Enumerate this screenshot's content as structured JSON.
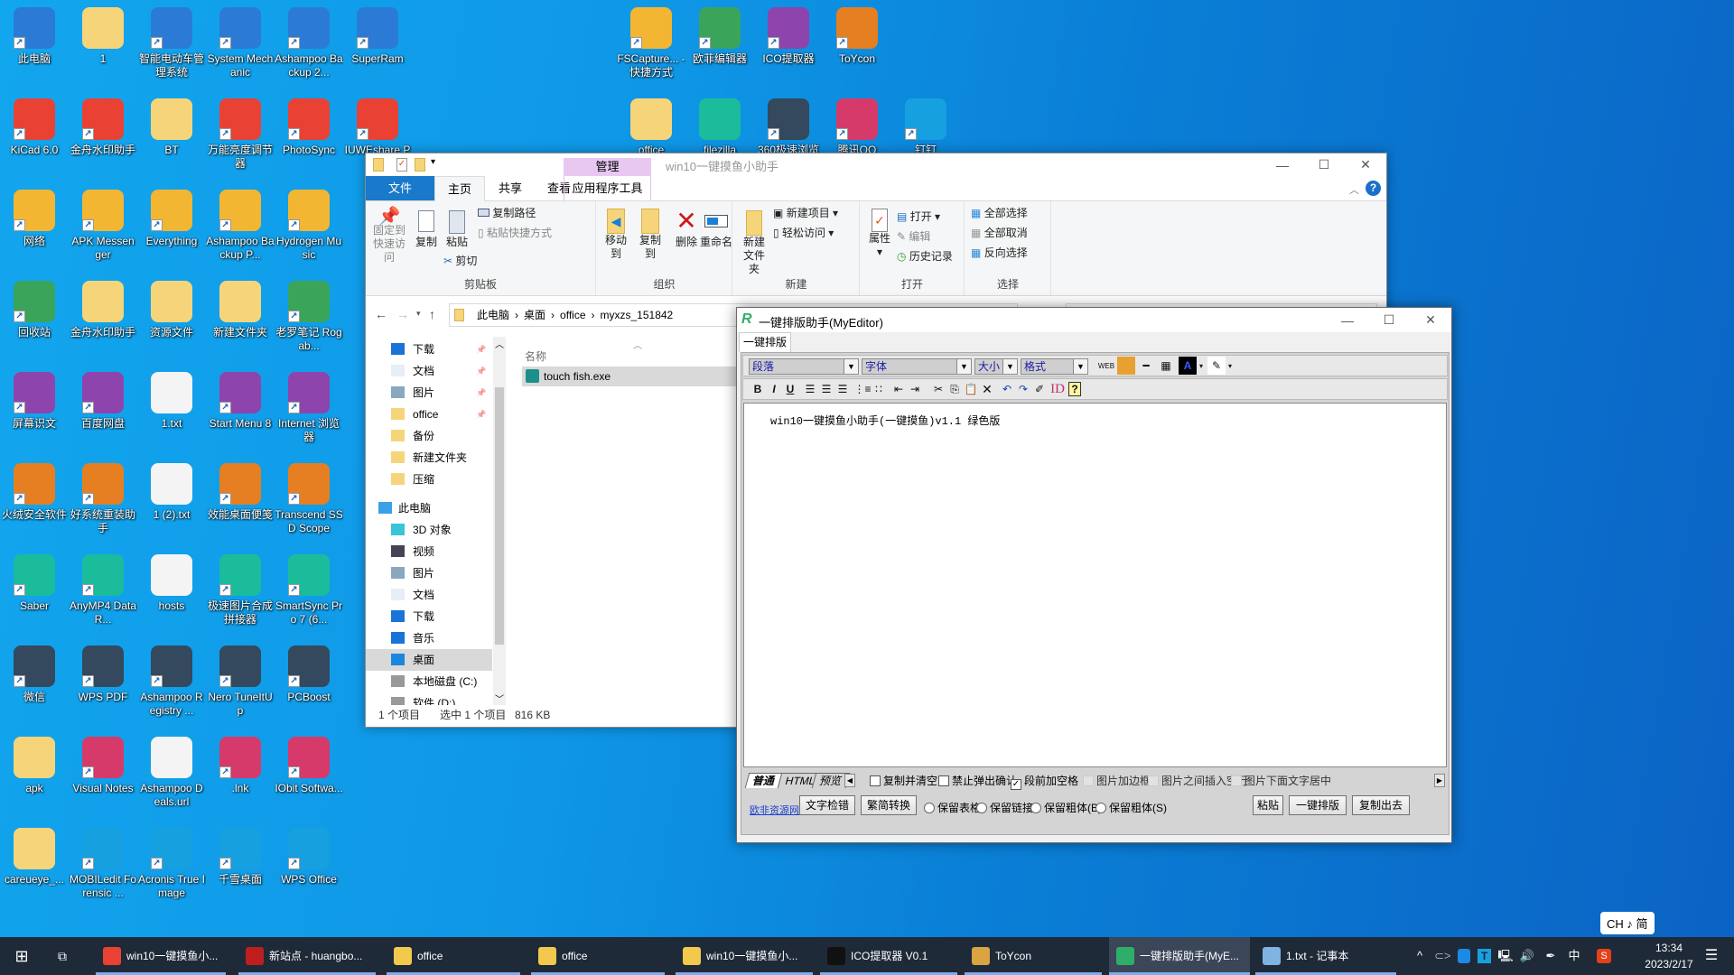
{
  "desktop": {
    "columns": [
      [
        {
          "label": "此电脑",
          "icon": "computer-icon"
        },
        {
          "label": "KiCad 6.0",
          "icon": "kicad-icon"
        },
        {
          "label": "网络",
          "icon": "network-icon"
        },
        {
          "label": "回收站",
          "icon": "recycle-bin-icon"
        },
        {
          "label": "屏幕识文",
          "icon": "ocr-icon"
        },
        {
          "label": "火绒安全软件",
          "icon": "huorong-icon"
        },
        {
          "label": "Saber",
          "icon": "saber-icon"
        },
        {
          "label": "微信",
          "icon": "wechat-icon"
        },
        {
          "label": "apk",
          "icon": "folder-icon"
        },
        {
          "label": "careueye_...",
          "icon": "folder-icon"
        }
      ],
      [
        {
          "label": "1",
          "icon": "folder-icon"
        },
        {
          "label": "金舟水印助手",
          "icon": "watermark-icon"
        },
        {
          "label": "APK Messenger",
          "icon": "apk-messenger-icon"
        },
        {
          "label": "金舟水印助手",
          "icon": "folder-icon"
        },
        {
          "label": "百度网盘",
          "icon": "baidu-netdisk-icon"
        },
        {
          "label": "好系统重装助手",
          "icon": "reinstall-icon"
        },
        {
          "label": "AnyMP4 Data R...",
          "icon": "anymp4-icon"
        },
        {
          "label": "WPS PDF",
          "icon": "wps-pdf-icon"
        },
        {
          "label": "Visual Notes",
          "icon": "notes-icon"
        },
        {
          "label": "MOBILedit Forensic ...",
          "icon": "mobiledit-icon"
        }
      ],
      [
        {
          "label": "智能电动车管理系统",
          "icon": "ev-icon"
        },
        {
          "label": "BT",
          "icon": "folder-icon"
        },
        {
          "label": "Everything",
          "icon": "search-icon"
        },
        {
          "label": "资源文件",
          "icon": "folder-icon"
        },
        {
          "label": "1.txt",
          "icon": "text-file-icon"
        },
        {
          "label": "1 (2).txt",
          "icon": "text-file-icon"
        },
        {
          "label": "hosts",
          "icon": "file-icon"
        },
        {
          "label": "Ashampoo Registry ...",
          "icon": "ashampoo-registry-icon"
        },
        {
          "label": "Ashampoo Deals.url",
          "icon": "file-icon"
        },
        {
          "label": "Acronis True Image",
          "icon": "acronis-icon"
        }
      ],
      [
        {
          "label": "System Mechanic",
          "icon": "system-mechanic-icon"
        },
        {
          "label": "万能亮度调节器",
          "icon": "moon-icon"
        },
        {
          "label": "Ashampoo Backup P...",
          "icon": "ashampoo-backup-icon"
        },
        {
          "label": "新建文件夹",
          "icon": "folder-icon"
        },
        {
          "label": "Start Menu 8",
          "icon": "windows-icon"
        },
        {
          "label": "效能桌面便笺",
          "icon": "sticky-note-icon"
        },
        {
          "label": "极速图片合成拼接器",
          "icon": "image-merge-icon"
        },
        {
          "label": "Nero TuneItUp",
          "icon": "nero-icon"
        },
        {
          "label": ".lnk",
          "icon": "speed-icon"
        },
        {
          "label": "千雪桌面",
          "icon": "snowflake-icon"
        }
      ],
      [
        {
          "label": "Ashampoo Backup 2...",
          "icon": "ashampoo-backup-icon"
        },
        {
          "label": "PhotoSync",
          "icon": "photosync-icon"
        },
        {
          "label": "Hydrogen Music",
          "icon": "hydrogen-music-icon"
        },
        {
          "label": "老罗笔记 Rogab...",
          "icon": "keyboard-icon"
        },
        {
          "label": "Internet 浏览器",
          "icon": "browser-icon"
        },
        {
          "label": "Transcend SSD Scope",
          "icon": "ssd-icon"
        },
        {
          "label": "SmartSync Pro 7 (6...",
          "icon": "smartsync-icon"
        },
        {
          "label": "PCBoost",
          "icon": "cpu-icon"
        },
        {
          "label": "IObit Softwa...",
          "icon": "iobit-icon"
        },
        {
          "label": "WPS Office",
          "icon": "wps-icon"
        }
      ],
      [
        {
          "label": "SuperRam",
          "icon": "ram-icon"
        },
        {
          "label": "IUWEshare Pho...",
          "icon": "iuweshare-icon"
        }
      ]
    ],
    "top_rows": [
      [
        {
          "label": "FSCapture... - 快捷方式",
          "icon": "fscapture-icon"
        },
        {
          "label": "欧菲编辑器",
          "icon": "ofei-editor-icon"
        },
        {
          "label": "ICO提取器",
          "icon": "ico-extractor-icon"
        },
        {
          "label": "ToYcon",
          "icon": "toycon-icon"
        }
      ],
      [
        {
          "label": "office",
          "icon": "folder-icon"
        },
        {
          "label": "filezilla",
          "icon": "filezilla-icon"
        },
        {
          "label": "360极速浏览器",
          "icon": "360-browser-icon"
        },
        {
          "label": "腾讯QQ",
          "icon": "qq-icon"
        },
        {
          "label": "钉钉",
          "icon": "dingtalk-icon"
        }
      ]
    ]
  },
  "explorer": {
    "title": "win10一键摸鱼小助手",
    "context_tab": "管理",
    "tabs": {
      "file": "文件",
      "home": "主页",
      "share": "共享",
      "view": "查看",
      "app_tools": "应用程序工具"
    },
    "ribbon": {
      "clipboard": {
        "label": "剪贴板",
        "pin": "固定到快速访问",
        "copy": "复制",
        "paste": "粘贴",
        "copy_path": "复制路径",
        "paste_shortcut": "粘贴快捷方式",
        "cut": "剪切"
      },
      "organize": {
        "label": "组织",
        "move_to": "移动到",
        "copy_to": "复制到",
        "delete": "删除",
        "rename": "重命名"
      },
      "new": {
        "label": "新建",
        "new_folder": "新建文件夹",
        "new_item": "新建项目",
        "easy_access": "轻松访问"
      },
      "open": {
        "label": "打开",
        "properties": "属性",
        "open": "打开",
        "edit": "编辑",
        "history": "历史记录"
      },
      "select": {
        "label": "选择",
        "select_all": "全部选择",
        "select_none": "全部取消",
        "invert": "反向选择"
      }
    },
    "breadcrumb": [
      "此电脑",
      "桌面",
      "office",
      "myxzs_151842"
    ],
    "nav": [
      {
        "label": "下载",
        "icon": "download-icon",
        "pinned": true
      },
      {
        "label": "文档",
        "icon": "document-icon",
        "pinned": true
      },
      {
        "label": "图片",
        "icon": "picture-icon",
        "pinned": true
      },
      {
        "label": "office",
        "icon": "folder-icon",
        "pinned": true
      },
      {
        "label": "备份",
        "icon": "folder-icon"
      },
      {
        "label": "新建文件夹",
        "icon": "folder-icon"
      },
      {
        "label": "压缩",
        "icon": "folder-icon"
      },
      {
        "label": "此电脑",
        "icon": "computer-icon",
        "root": true
      },
      {
        "label": "3D 对象",
        "icon": "3d-objects-icon"
      },
      {
        "label": "视频",
        "icon": "video-icon"
      },
      {
        "label": "图片",
        "icon": "picture-icon"
      },
      {
        "label": "文档",
        "icon": "document-icon"
      },
      {
        "label": "下载",
        "icon": "download-icon"
      },
      {
        "label": "音乐",
        "icon": "music-icon"
      },
      {
        "label": "桌面",
        "icon": "desktop-icon",
        "selected": true
      },
      {
        "label": "本地磁盘 (C:)",
        "icon": "drive-icon"
      },
      {
        "label": "软件 (D:)",
        "icon": "drive-icon"
      }
    ],
    "column_name": "名称",
    "files": [
      {
        "name": "touch fish.exe",
        "selected": true
      }
    ],
    "status": {
      "items": "1 个项目",
      "selected": "选中 1 个项目",
      "size": "816 KB"
    }
  },
  "editor": {
    "title": "一键排版助手(MyEditor)",
    "tab": "一键排版助手",
    "selects": {
      "paragraph": "段落",
      "font": "字体",
      "size": "大小",
      "format": "格式"
    },
    "content": "win10一键摸鱼小助手(一键摸鱼)v1.1 绿色版",
    "mode_tabs": [
      "普通",
      "HTML",
      "预览"
    ],
    "checkboxes": [
      {
        "label": "复制并清空",
        "checked": false,
        "enabled": true
      },
      {
        "label": "禁止弹出确认",
        "checked": false,
        "enabled": true
      },
      {
        "label": "段前加空格",
        "checked": true,
        "enabled": true
      },
      {
        "label": "图片加边框",
        "checked": false,
        "enabled": false
      },
      {
        "label": "图片之间插入空行",
        "checked": false,
        "enabled": false
      },
      {
        "label": "图片下面文字居中",
        "checked": false,
        "enabled": false
      }
    ],
    "link": "欧非资源网",
    "buttons": {
      "spell": "文字检错",
      "convert": "繁简转换",
      "paste": "粘贴",
      "format": "一键排版",
      "copy_out": "复制出去"
    },
    "radios": [
      "保留表格",
      "保留链接",
      "保留粗体(B)",
      "保留粗体(S)"
    ]
  },
  "taskbar": {
    "items": [
      {
        "label": "win10一键摸鱼小...",
        "icon": "chrome-icon",
        "color": "#e94235"
      },
      {
        "label": "新站点 - huangbo...",
        "icon": "filezilla-icon",
        "color": "#bf1e1e"
      },
      {
        "label": "office",
        "icon": "folder-icon",
        "color": "#f2c94c"
      },
      {
        "label": "office",
        "icon": "folder-icon",
        "color": "#f2c94c"
      },
      {
        "label": "win10一键摸鱼小...",
        "icon": "folder-icon",
        "color": "#f2c94c"
      },
      {
        "label": "ICO提取器 V0.1",
        "icon": "ico-extractor-icon",
        "color": "#111111"
      },
      {
        "label": "ToYcon",
        "icon": "toycon-icon",
        "color": "#d9a441"
      },
      {
        "label": "一键排版助手(MyE...",
        "icon": "myeditor-icon",
        "color": "#2fae6a",
        "active": true
      },
      {
        "label": "1.txt - 记事本",
        "icon": "notepad-icon",
        "color": "#7fb3e0"
      }
    ],
    "ime": "中",
    "time": "13:34",
    "date": "2023/2/17",
    "ime_popup": "CH ♪ 简"
  }
}
